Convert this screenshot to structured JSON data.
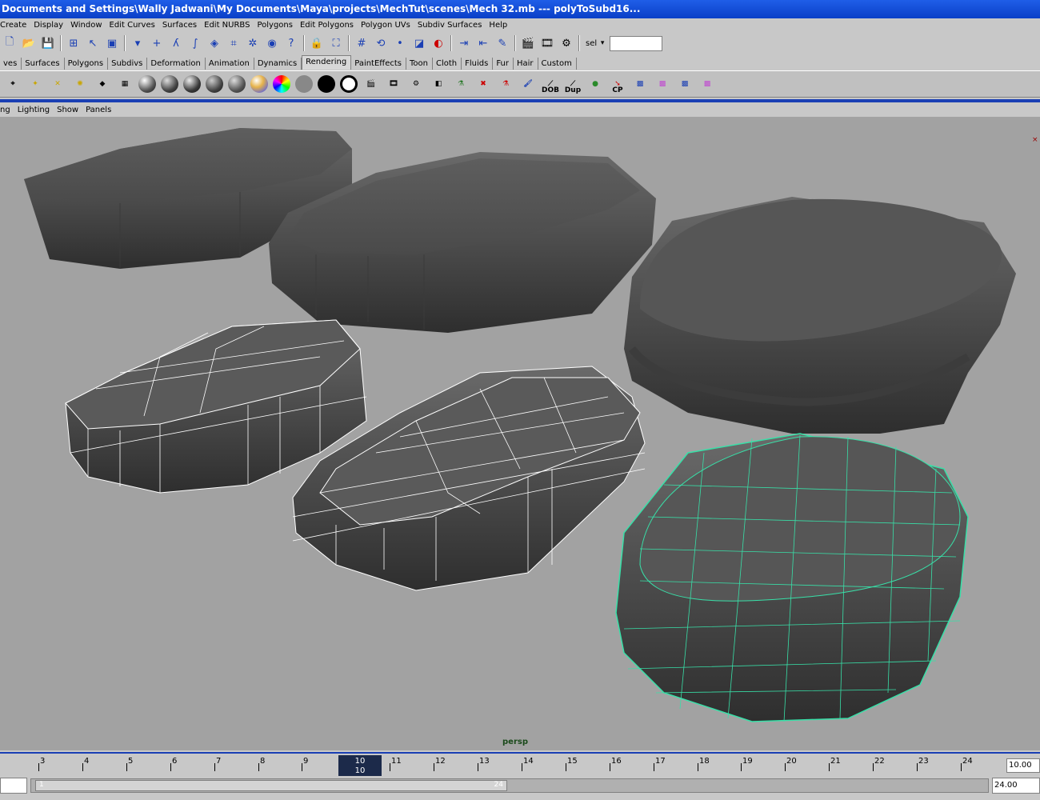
{
  "window": {
    "title": "Documents and Settings\\Wally Jadwani\\My Documents\\Maya\\projects\\MechTut\\scenes\\Mech 32.mb   ---   polyToSubd16..."
  },
  "menubar": [
    "Create",
    "Display",
    "Window",
    "Edit Curves",
    "Surfaces",
    "Edit NURBS",
    "Polygons",
    "Edit Polygons",
    "Polygon UVs",
    "Subdiv Surfaces",
    "Help"
  ],
  "statusline": {
    "sel_label": "sel",
    "sel_value": ""
  },
  "shelf_tabs": {
    "items": [
      "ves",
      "Surfaces",
      "Polygons",
      "Subdivs",
      "Deformation",
      "Animation",
      "Dynamics",
      "Rendering",
      "PaintEffects",
      "Toon",
      "Cloth",
      "Fluids",
      "Fur",
      "Hair",
      "Custom"
    ],
    "active": "Rendering"
  },
  "shelf": {
    "labels": {
      "dob": "DOB",
      "dup": "Dup",
      "cp": "CP"
    }
  },
  "panel_menu": [
    "ng",
    "Lighting",
    "Show",
    "Panels"
  ],
  "viewport": {
    "camera": "persp",
    "background_color": "#a2a2a2",
    "wireframe_color": "#38e0a8"
  },
  "timeline": {
    "ticks": [
      "3",
      "4",
      "5",
      "6",
      "7",
      "8",
      "9",
      "10",
      "11",
      "12",
      "13",
      "14",
      "15",
      "16",
      "17",
      "18",
      "19",
      "20",
      "21",
      "22",
      "23",
      "24"
    ],
    "current_frame": "10",
    "current_frame_sub": "10",
    "end_value": "10.00"
  },
  "range": {
    "start_value": "",
    "end_value": "24.00",
    "handle_start": "1",
    "handle_end": "24"
  },
  "colors": {
    "titlebar": "#0a3fc7",
    "ui_gray": "#c8c8c8",
    "accent_blue": "#1a3fb4"
  }
}
